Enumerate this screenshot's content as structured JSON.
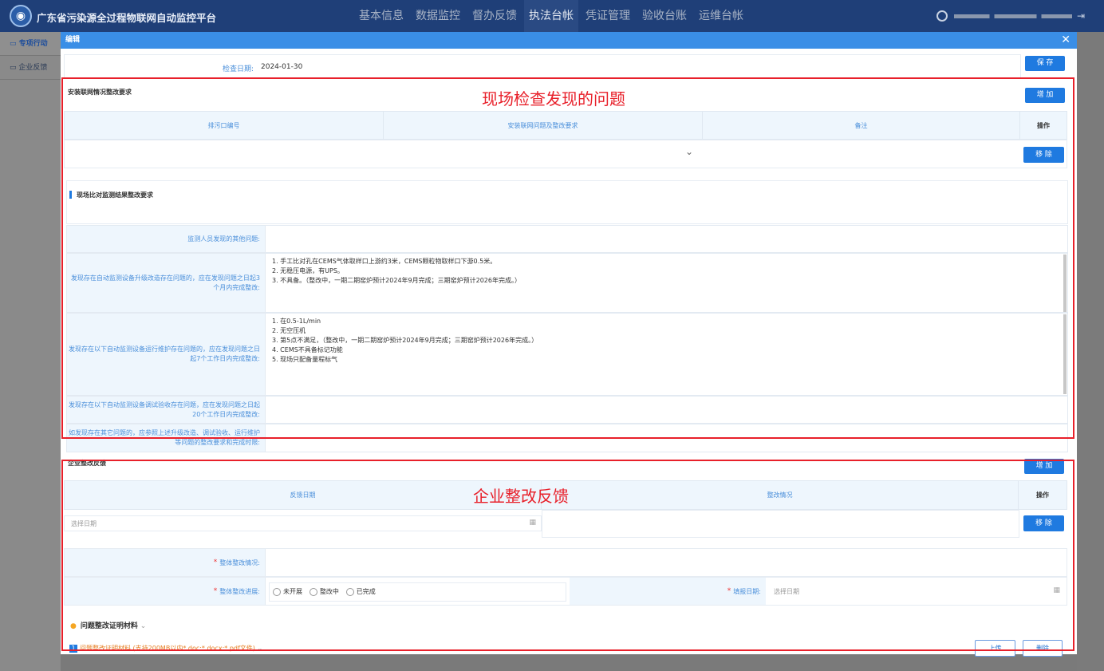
{
  "header": {
    "logo_glyph": "◉",
    "title": "广东省污染源全过程物联网自动监控平台",
    "nav": [
      "基本信息",
      "数据监控",
      "督办反馈",
      "执法台帐",
      "凭证管理",
      "验收台账",
      "运维台帐"
    ],
    "active_nav": "执法台帐"
  },
  "sidebar": {
    "items": [
      "专项行动",
      "企业反馈"
    ]
  },
  "modal": {
    "title": "编辑",
    "close_glyph": "✕",
    "save_label": "保 存",
    "date_label": "检查日期:",
    "date_value": "2024-01-30",
    "install_section": {
      "title": "安装联网情况整改要求",
      "add_label": "增 加",
      "columns": [
        "排污口编号",
        "安装联网问题及整改要求",
        "备注",
        "操作"
      ],
      "remove_label": "移 除",
      "dropdown_glyph": "⌄"
    },
    "compare_section": {
      "title": "现场比对监测结果整改要求",
      "rows": [
        {
          "label": "监测人员发现的其他问题:",
          "value": ""
        },
        {
          "label": "发现存在自动监测设备升级改造存在问题的，应在发现问题之日起3个月内完成整改:",
          "value": "1. 手工比对孔在CEMS气体取样口上游约3米，CEMS颗粒物取样口下游0.5米。\n2. 无稳压电源，有UPS。\n3. 不具备。（整改中，一期二期窑炉预计2024年9月完成；三期窑炉预计2026年完成。）"
        },
        {
          "label": "发现存在以下自动监测设备运行维护存在问题的，应在发现问题之日起7个工作日内完成整改:",
          "value": "1. 在0.5-1L/min\n2. 无空压机\n3. 第5点不满足，（整改中，一期二期窑炉预计2024年9月完成；三期窑炉预计2026年完成。）\n4. CEMS不具备标记功能\n5. 现场只配备量程标气"
        },
        {
          "label": "发现存在以下自动监测设备调试验收存在问题，应在发现问题之日起20个工作日内完成整改:",
          "value": ""
        },
        {
          "label": "如发现存在其它问题的，应参照上述升级改造、调试验收、运行维护等问题的整改要求和完成时限:",
          "value": ""
        }
      ]
    },
    "feedback_section": {
      "title": "企业整改反馈",
      "add_label": "增 加",
      "columns": [
        "反馈日期",
        "整改情况",
        "操作"
      ],
      "date_placeholder": "选择日期",
      "remove_label": "移 除",
      "overall_label": "整体整改情况:",
      "progress_label": "整体整改进展:",
      "progress_options": [
        "未开展",
        "整改中",
        "已完成"
      ],
      "report_date_label": "填报日期:",
      "report_date_placeholder": "选择日期",
      "materials_title": "问题整改证明材料",
      "materials_item_index": "1",
      "materials_item": "问题整改证明材料",
      "materials_hint": "(支持200MB以内*.doc;*.docx;*.pdf文件)",
      "upload_label": "上传",
      "delete_label": "删除"
    }
  },
  "annotations": {
    "problems": "现场检查发现的问题",
    "feedback": "企业整改反馈"
  },
  "colors": {
    "topbar": "#1f3f78",
    "primary": "#1f7ae0",
    "annotation": "#e8202a"
  }
}
